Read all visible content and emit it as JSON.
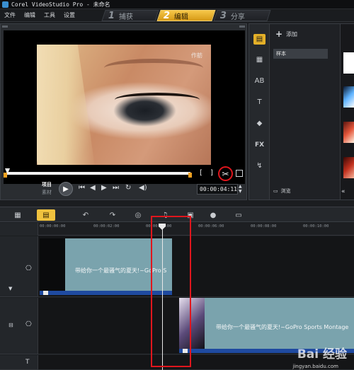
{
  "window": {
    "title": "Corel VideoStudio Pro - 未命名"
  },
  "menu": [
    "文件",
    "编辑",
    "工具",
    "设置"
  ],
  "steps": [
    {
      "num": "1",
      "label": "捕获"
    },
    {
      "num": "2",
      "label": "编辑"
    },
    {
      "num": "3",
      "label": "分享"
    }
  ],
  "preview": {
    "watermark": "作舫",
    "mode_project": "项目",
    "mode_clip": "素材",
    "timecode": "00:00:04:11",
    "bracket_in": "[",
    "bracket_out": "]"
  },
  "library": {
    "add_label": "添加",
    "item": "样本",
    "browse_label": "浏览"
  },
  "ruler": {
    "ticks": [
      "00:00:00:00",
      "00:00:02:00",
      "00:00:04:00",
      "00:00:06:00",
      "00:00:08:00",
      "00:00:10:00"
    ]
  },
  "tracks": {
    "clip1_title": "带给你一个最骚气的夏天!~GoPro S",
    "clip2_title": "带给你一个最骚气的夏天!~GoPro Sports Montage"
  },
  "watermark_site": {
    "logo": "Bai 经验",
    "url": "jingyan.baidu.com"
  },
  "colors": {
    "accent": "#f0c23e",
    "highlight_red": "#e0161d",
    "clip_blue": "#1f4aa0",
    "clip_teal": "#7aa3ad"
  }
}
